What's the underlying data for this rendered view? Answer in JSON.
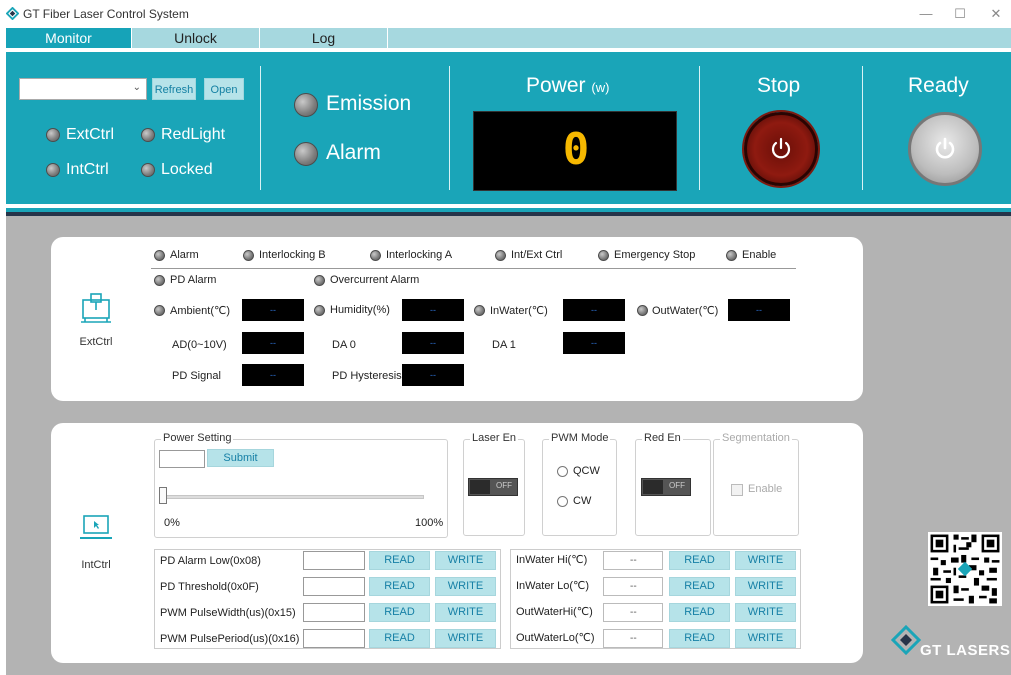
{
  "window": {
    "title": "GT Fiber Laser Control System",
    "minimize": "—",
    "maximize": "☐",
    "close": "✕"
  },
  "tabs": [
    {
      "label": "Monitor",
      "active": true
    },
    {
      "label": "Unlock",
      "active": false
    },
    {
      "label": "Log",
      "active": false
    }
  ],
  "header": {
    "refresh_label": "Refresh",
    "open_label": "Open",
    "port_value": "",
    "indicators": {
      "extctrl": "ExtCtrl",
      "redlight": "RedLight",
      "intctrl": "IntCtrl",
      "locked": "Locked"
    },
    "emission": "Emission",
    "alarm": "Alarm",
    "power_title": "Power",
    "power_unit": "(w)",
    "power_value": "0",
    "stop_label": "Stop",
    "ready_label": "Ready"
  },
  "ext_panel": {
    "side_label": "ExtCtrl",
    "status_row": [
      "Alarm",
      "Interlocking B",
      "Interlocking A",
      "Int/Ext Ctrl",
      "Emergency Stop",
      "Enable"
    ],
    "status_row2": [
      "PD Alarm",
      "Overcurrent Alarm"
    ],
    "sensors": [
      {
        "label": "Ambient(℃)",
        "value": "--"
      },
      {
        "label": "Humidity(%)",
        "value": "--"
      },
      {
        "label": "InWater(℃)",
        "value": "--"
      },
      {
        "label": "OutWater(℃)",
        "value": "--"
      }
    ],
    "analog": [
      {
        "label": "AD(0~10V)",
        "value": "--"
      },
      {
        "label": "DA 0",
        "value": "--"
      },
      {
        "label": "DA 1",
        "value": "--"
      }
    ],
    "pd": [
      {
        "label": "PD Signal",
        "value": "--"
      },
      {
        "label": "PD Hysteresis",
        "value": "--"
      }
    ]
  },
  "int_panel": {
    "side_label": "IntCtrl",
    "power_setting": {
      "title": "Power Setting",
      "input_value": "",
      "submit_label": "Submit",
      "slider_min": "0%",
      "slider_max": "100%",
      "slider_value": 0
    },
    "laser_en": {
      "title": "Laser En",
      "state": "OFF"
    },
    "pwm_mode": {
      "title": "PWM Mode",
      "options": [
        "QCW",
        "CW"
      ]
    },
    "red_en": {
      "title": "Red En",
      "state": "OFF"
    },
    "segmentation": {
      "title": "Segmentation",
      "enable_label": "Enable"
    },
    "read_label": "READ",
    "write_label": "WRITE",
    "left_rows": [
      {
        "label": "PD Alarm Low(0x08)",
        "value": ""
      },
      {
        "label": "PD Threshold(0x0F)",
        "value": ""
      },
      {
        "label": "PWM PulseWidth(us)(0x15)",
        "value": ""
      },
      {
        "label": "PWM PulsePeriod(us)(0x16)",
        "value": ""
      }
    ],
    "right_rows": [
      {
        "label": "InWater Hi(℃)",
        "value": "--"
      },
      {
        "label": "InWater Lo(℃)",
        "value": "--"
      },
      {
        "label": "OutWaterHi(℃)",
        "value": "--"
      },
      {
        "label": "OutWaterLo(℃)",
        "value": "--"
      }
    ]
  },
  "brand": {
    "name": "GT LASERS"
  },
  "colors": {
    "accent": "#1aa5b8",
    "tab_bg": "#a6d8df",
    "button_bg": "#b6e3e9",
    "power_digit": "#f6b800",
    "stop_red": "#8f1a10"
  }
}
